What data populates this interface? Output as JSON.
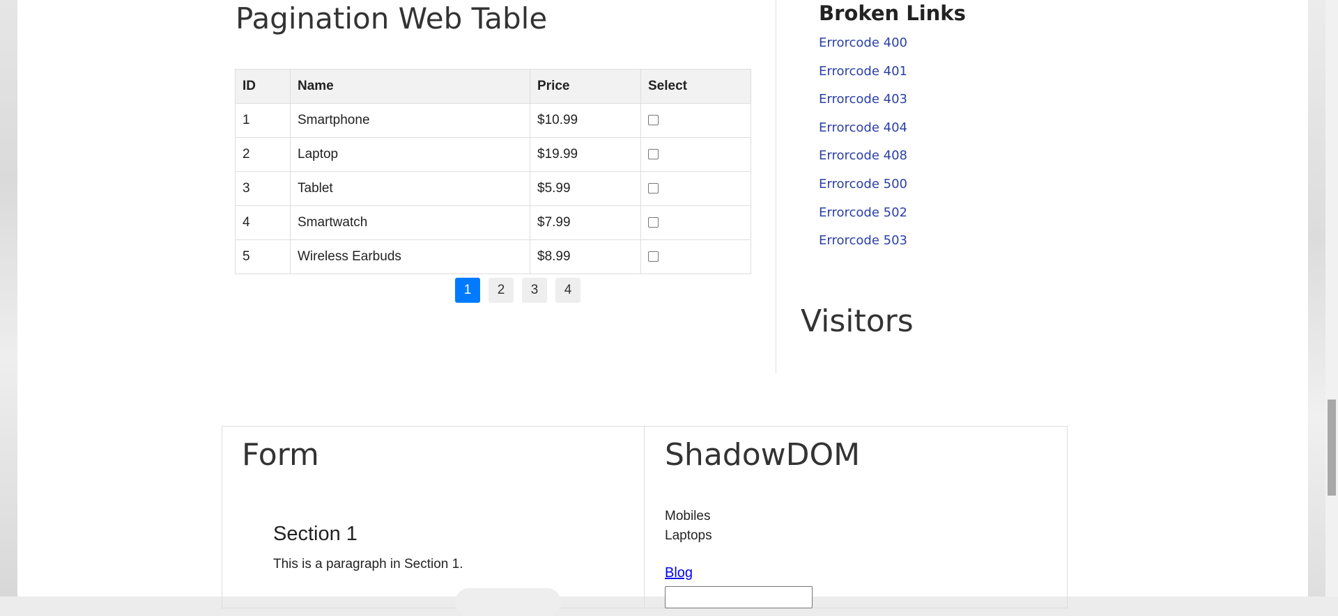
{
  "pagination_table": {
    "title": "Pagination Web Table",
    "headers": [
      "ID",
      "Name",
      "Price",
      "Select"
    ],
    "rows": [
      {
        "id": "1",
        "name": "Smartphone",
        "price": "$10.99",
        "selected": false
      },
      {
        "id": "2",
        "name": "Laptop",
        "price": "$19.99",
        "selected": false
      },
      {
        "id": "3",
        "name": "Tablet",
        "price": "$5.99",
        "selected": false
      },
      {
        "id": "4",
        "name": "Smartwatch",
        "price": "$7.99",
        "selected": false
      },
      {
        "id": "5",
        "name": "Wireless Earbuds",
        "price": "$8.99",
        "selected": false
      }
    ],
    "pages": [
      "1",
      "2",
      "3",
      "4"
    ],
    "active_page": "1"
  },
  "broken_links": {
    "title": "Broken Links",
    "links": [
      "Errorcode 400",
      "Errorcode 401",
      "Errorcode 403",
      "Errorcode 404",
      "Errorcode 408",
      "Errorcode 500",
      "Errorcode 502",
      "Errorcode 503"
    ]
  },
  "visitors": {
    "title": "Visitors"
  },
  "form": {
    "title": "Form",
    "section_title": "Section 1",
    "section_paragraph": "This is a paragraph in Section 1."
  },
  "shadow_dom": {
    "title": "ShadowDOM",
    "items": [
      "Mobiles",
      "Laptops"
    ],
    "link": "Blog"
  },
  "colors": {
    "accent": "#007bff",
    "link": "#2a3fa6"
  }
}
